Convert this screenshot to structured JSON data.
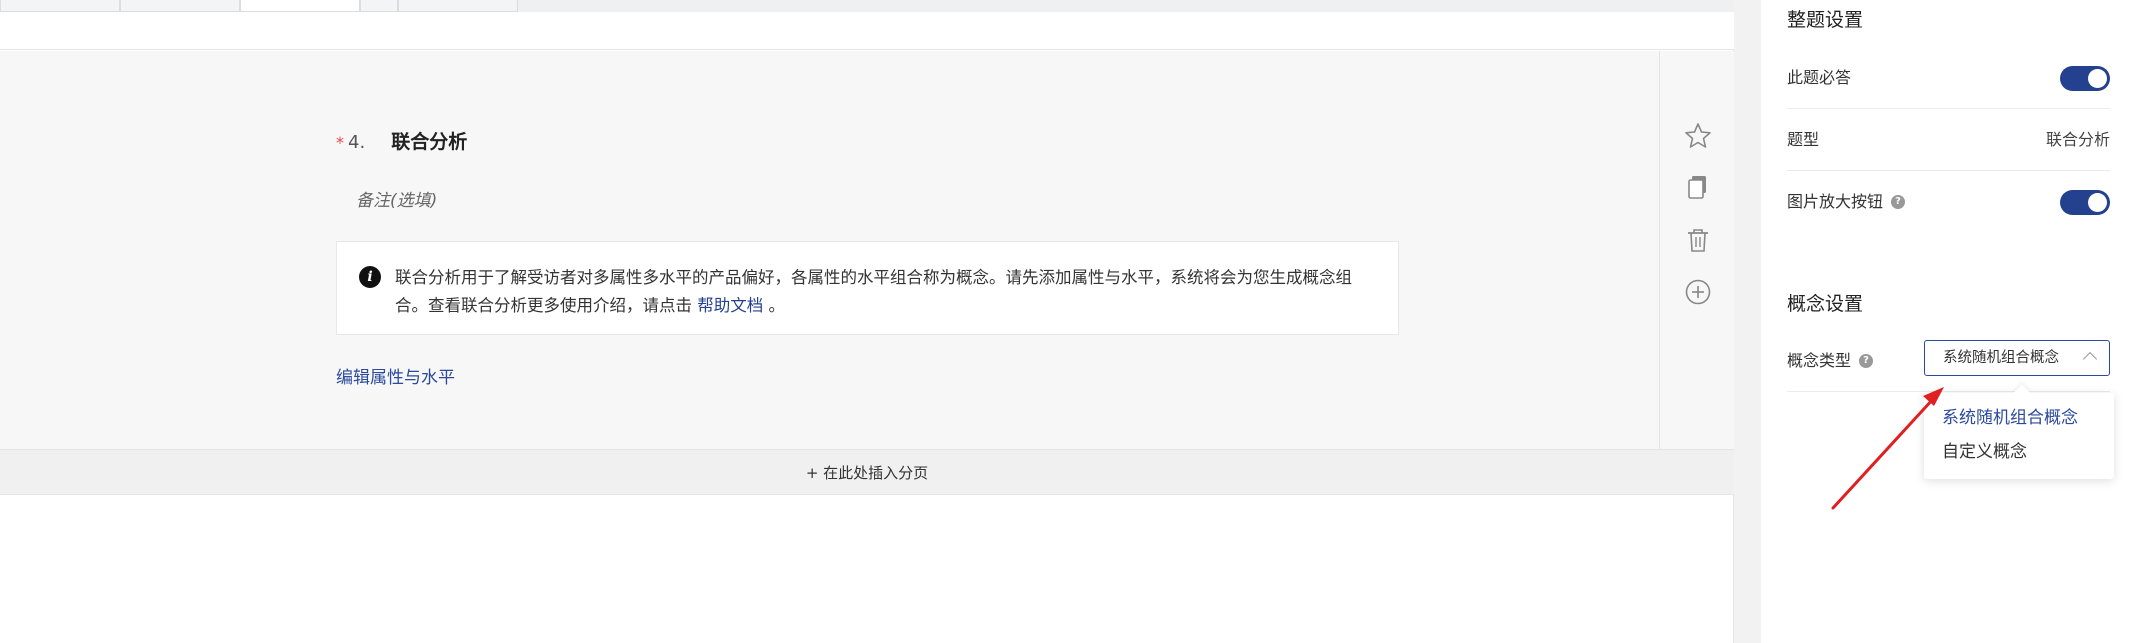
{
  "tabs": [
    "",
    "",
    "",
    "",
    ""
  ],
  "question": {
    "required_mark": "*",
    "number": "4.",
    "title": "联合分析",
    "note_placeholder": "备注(选填)",
    "info_text": "联合分析用于了解受访者对多属性多水平的产品偏好，各属性的水平组合称为概念。请先添加属性与水平，系统将会为您生成概念组合。查看联合分析更多使用介绍，请点击",
    "info_link": "帮助文档",
    "info_suffix": "。",
    "edit_link": "编辑属性与水平"
  },
  "tools": [
    "star-icon",
    "copy-icon",
    "trash-icon",
    "add-circle-icon"
  ],
  "insert_bar": "+ 在此处插入分页",
  "side": {
    "whole_title": "整题设置",
    "required_label": "此题必答",
    "required_on": true,
    "type_label": "题型",
    "type_value": "联合分析",
    "zoom_label": "图片放大按钮",
    "zoom_on": true,
    "concept_title": "概念设置",
    "concept_type_label": "概念类型",
    "concept_type_value": "系统随机组合概念",
    "options": [
      "系统随机组合概念",
      "自定义概念"
    ]
  },
  "colors": {
    "accent": "#24418f",
    "required": "#ee4444",
    "arrow": "#e02020"
  }
}
